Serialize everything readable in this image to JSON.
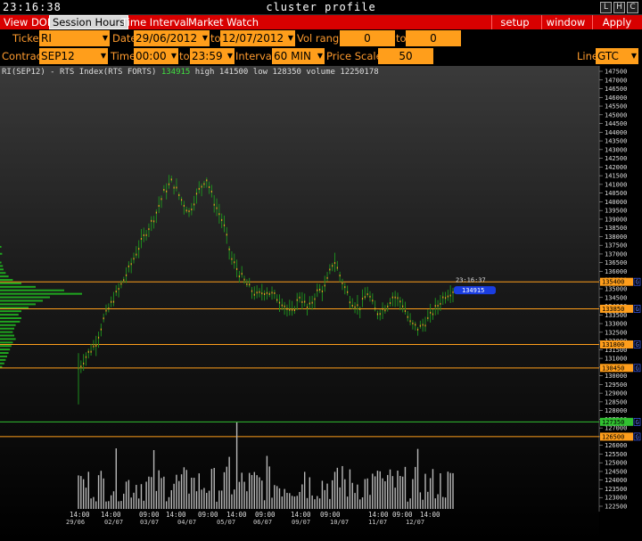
{
  "window": {
    "clock": "23:16:38",
    "title": "cluster profile",
    "buttons": [
      "L",
      "H",
      "C"
    ]
  },
  "menu": {
    "tabs": [
      "View DOM",
      "Session Hours",
      "Time Interval",
      "Market Watch"
    ],
    "active_tab": "Session Hours",
    "right_buttons": [
      "setup",
      "window",
      "Apply"
    ]
  },
  "controls": {
    "ticker_label": "Ticker",
    "ticker": "RI",
    "date_label": "Date",
    "date_from": "29/06/2012",
    "to_label": "to",
    "date_to": "12/07/2012",
    "vol_range_label": "Vol range",
    "vol_from": "0",
    "vol_to_label": "to",
    "vol_to": "0",
    "contract_label": "Contract",
    "contract": "SEP12",
    "time_label": "Time",
    "time_from": "00:00",
    "time_to_label": "to",
    "time_to": "23:59",
    "interval_label": "Interval",
    "interval": "60 MIN",
    "price_scale_label": "Price Scale",
    "price_scale": "50",
    "line_label": "Line",
    "line": "GTC"
  },
  "chart_info": {
    "symbol": "RI(SEP12) - RTS Index(RTS FORTS)",
    "last": "134915",
    "high": "high 141500",
    "low": "low 128350",
    "volume": "volume 12250178"
  },
  "chart_data": {
    "type": "bar",
    "price_axis": {
      "min": 122500,
      "max": 147500,
      "step": 500
    },
    "current_time_label": "23:16:37",
    "current_price_label": "134915",
    "current_price": 134915,
    "levels": [
      {
        "price": 135400,
        "label": "135400",
        "color": "#ff9e1b"
      },
      {
        "price": 133850,
        "label": "133850",
        "color": "#ff9e1b"
      },
      {
        "price": 131800,
        "label": "131800",
        "color": "#ff9e1b"
      },
      {
        "price": 130450,
        "label": "130450",
        "color": "#ff9e1b"
      },
      {
        "price": 127350,
        "label": "127350",
        "color": "#30c030"
      },
      {
        "price": 126500,
        "label": "126500",
        "color": "#ff9e1b"
      }
    ],
    "time_labels": [
      "14:00",
      "14:00",
      "09:00",
      "14:00",
      "09:00",
      "14:00",
      "09:00",
      "14:00",
      "09:00",
      "14:00",
      "09:00",
      "14:00"
    ],
    "date_labels": [
      "29/06",
      "02/07",
      "03/07",
      "04/07",
      "05/07",
      "06/07",
      "09/07",
      "10/07",
      "11/07",
      "12/07"
    ],
    "price_path": [
      130400,
      131200,
      131800,
      133300,
      134300,
      135200,
      136200,
      137300,
      138300,
      139200,
      140500,
      141200,
      140200,
      139400,
      140500,
      141400,
      139900,
      138800,
      136700,
      135800,
      135100,
      134600,
      134900,
      134600,
      134200,
      133500,
      134600,
      133800,
      134800,
      135100,
      136700,
      135400,
      134300,
      133900,
      134800,
      133600,
      133900,
      134600,
      134200,
      133000,
      132700,
      133200,
      133900,
      134600,
      134900
    ]
  }
}
